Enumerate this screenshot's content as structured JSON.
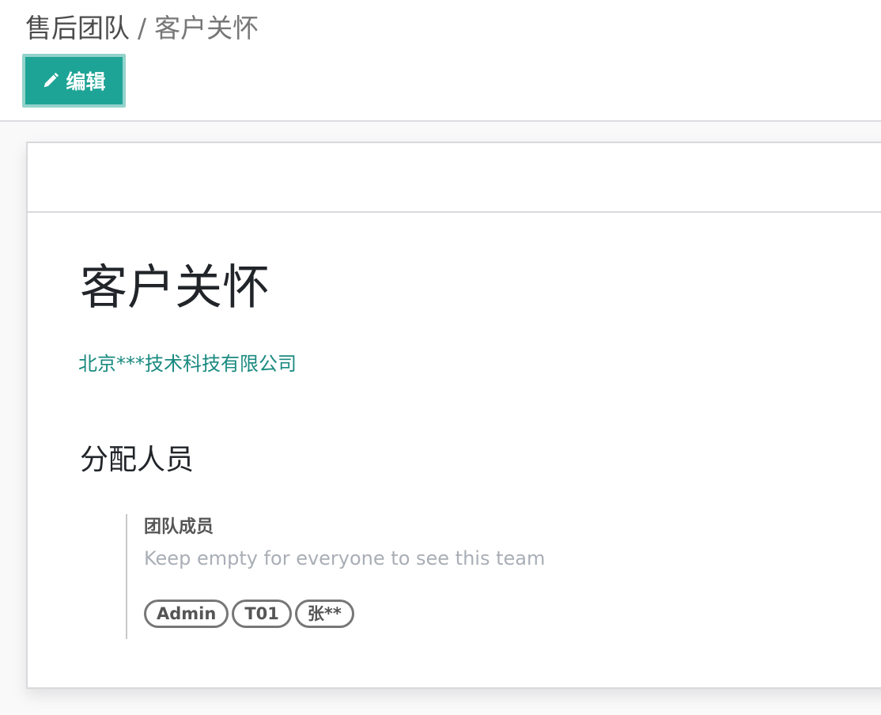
{
  "breadcrumb": {
    "parent": "售后团队",
    "separator": "/",
    "current": "客户关怀"
  },
  "toolbar": {
    "edit_label": "编辑",
    "edit_icon": "pencil-icon"
  },
  "record": {
    "title": "客户关怀",
    "company": "北京***技术科技有限公司"
  },
  "assignment": {
    "section_title": "分配人员",
    "members_label": "团队成员",
    "members_help": "Keep empty for everyone to see this team",
    "members": [
      "Admin",
      "T01",
      "张**"
    ]
  },
  "colors": {
    "primary": "#1ea496",
    "link": "#1a8a80",
    "text": "#212529",
    "muted": "#a9aeb6"
  }
}
